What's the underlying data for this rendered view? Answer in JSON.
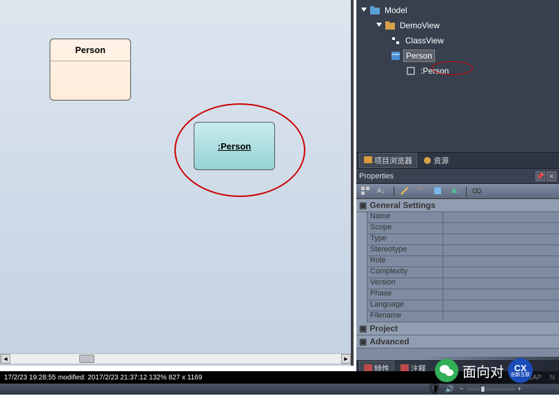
{
  "canvas": {
    "class_box_label": "Person",
    "object_box_label": ":Person"
  },
  "tree": {
    "root": "Model",
    "view": "DemoView",
    "items": [
      "ClassView",
      "Person",
      ":Person"
    ]
  },
  "tabs_mid": [
    {
      "label": "项目浏览器",
      "icon": "browser"
    },
    {
      "label": "资源",
      "icon": "resource"
    }
  ],
  "properties_title": "Properties",
  "prop_sections": {
    "general": "General Settings",
    "rows": [
      "Name",
      "Scope",
      "Type",
      "Stereotype",
      "Role",
      "Complexity",
      "Version",
      "Phase",
      "Language",
      "Filename"
    ],
    "project": "Project",
    "advanced": "Advanced"
  },
  "bottom_tabs": [
    {
      "label": "特性"
    },
    {
      "label": "注释"
    }
  ],
  "status": {
    "left": "17/2/23 19:28:55  modified: 2017/2/23 21:37:12   132%    827 x 1169",
    "cap": "CAP",
    "n": "N"
  },
  "watermark": {
    "text": "面向对",
    "badge": "创新互联"
  }
}
